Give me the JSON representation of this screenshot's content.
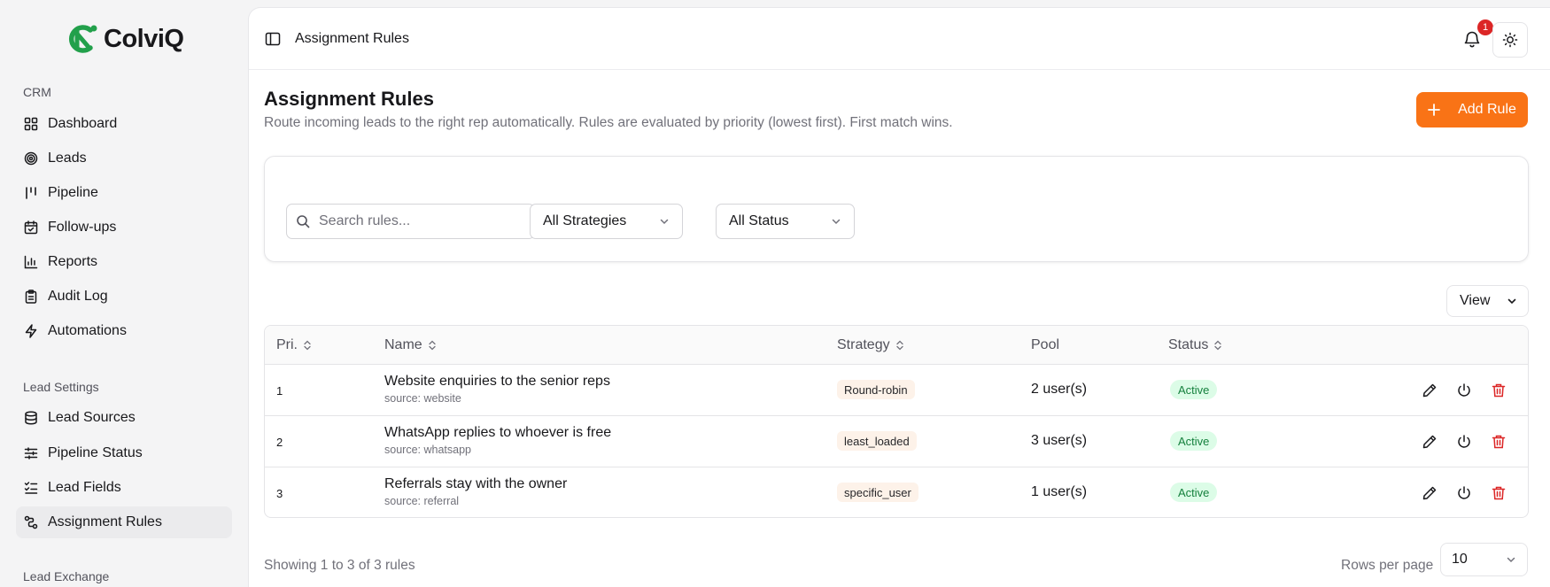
{
  "brand": {
    "name": "ColviQ",
    "accent": "#f97316",
    "logo_color": "#22a04b"
  },
  "sidebar": {
    "sections": [
      {
        "label": "CRM",
        "items": [
          {
            "label": "Dashboard",
            "icon": "grid-icon"
          },
          {
            "label": "Leads",
            "icon": "target-icon"
          },
          {
            "label": "Pipeline",
            "icon": "pipeline-icon"
          },
          {
            "label": "Follow-ups",
            "icon": "calendar-check-icon"
          },
          {
            "label": "Reports",
            "icon": "bar-chart-icon"
          },
          {
            "label": "Audit Log",
            "icon": "clipboard-icon"
          },
          {
            "label": "Automations",
            "icon": "zap-icon"
          }
        ]
      },
      {
        "label": "Lead Settings",
        "items": [
          {
            "label": "Lead Sources",
            "icon": "database-icon"
          },
          {
            "label": "Pipeline Status",
            "icon": "sliders-icon"
          },
          {
            "label": "Lead Fields",
            "icon": "list-checks-icon"
          },
          {
            "label": "Assignment Rules",
            "icon": "route-icon",
            "active": true
          }
        ]
      },
      {
        "label": "Lead Exchange",
        "items": []
      }
    ]
  },
  "header": {
    "title": "Assignment Rules",
    "notification_count": "1"
  },
  "page": {
    "title": "Assignment Rules",
    "subtitle": "Route incoming leads to the right rep automatically. Rules are evaluated by priority (lowest first). First match wins.",
    "add_button": "Add Rule"
  },
  "filters": {
    "search_placeholder": "Search rules...",
    "strategy": "All Strategies",
    "status": "All Status",
    "view": "View"
  },
  "table": {
    "columns": {
      "priority": "Pri.",
      "name": "Name",
      "strategy": "Strategy",
      "pool": "Pool",
      "status": "Status"
    },
    "rows": [
      {
        "priority": "1",
        "name": "Website enquiries to the senior reps",
        "source": "source: website",
        "strategy": "Round-robin",
        "pool": "2 user(s)",
        "status": "Active"
      },
      {
        "priority": "2",
        "name": "WhatsApp replies to whoever is free",
        "source": "source: whatsapp",
        "strategy": "least_loaded",
        "pool": "3 user(s)",
        "status": "Active"
      },
      {
        "priority": "3",
        "name": "Referrals stay with the owner",
        "source": "source: referral",
        "strategy": "specific_user",
        "pool": "1 user(s)",
        "status": "Active"
      }
    ]
  },
  "footer": {
    "showing": "Showing 1 to 3 of 3 rules",
    "rows_per_page_label": "Rows per page",
    "rows_per_page": "10"
  }
}
